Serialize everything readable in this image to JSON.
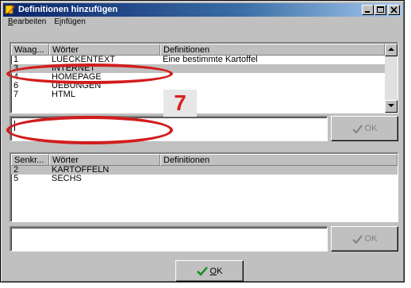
{
  "window": {
    "title": "Definitionen hinzufügen",
    "colors": {
      "titlebar": "#0a246a",
      "face": "#c0c0c0",
      "annotation": "#d21c1c"
    }
  },
  "menubar": {
    "items": [
      {
        "label": "Bearbeiten",
        "mnemonic": "B",
        "rest": "earbeiten"
      },
      {
        "label": "Einfügen",
        "mnemonic": "i",
        "pre": "E",
        "rest": "nfügen"
      }
    ]
  },
  "top_grid": {
    "headers": [
      "Waag...",
      "Wörter",
      "Definitionen"
    ],
    "rows": [
      {
        "num": "1",
        "word": "LUECKENTEXT",
        "def": "Eine bestimmte Kartoffel",
        "selected": false
      },
      {
        "num": "3",
        "word": "INTERNET",
        "def": "",
        "selected": true
      },
      {
        "num": "4",
        "word": "HOMEPAGE",
        "def": "",
        "selected": false
      },
      {
        "num": "6",
        "word": "UEBUNGEN",
        "def": "",
        "selected": false
      },
      {
        "num": "7",
        "word": "HTML",
        "def": "",
        "selected": false
      }
    ]
  },
  "top_input": {
    "value": ""
  },
  "top_ok": {
    "label": "OK"
  },
  "bottom_grid": {
    "headers": [
      "Senkr...",
      "Wörter",
      "Definitionen"
    ],
    "rows": [
      {
        "num": "2",
        "word": "KARTOFFELN",
        "def": "",
        "selected": true
      },
      {
        "num": "5",
        "word": "SECHS",
        "def": "",
        "selected": false
      }
    ]
  },
  "bottom_input": {
    "value": ""
  },
  "bottom_ok": {
    "label": "OK"
  },
  "main_ok": {
    "label": "OK",
    "mnemonic": "O",
    "rest": "K"
  },
  "annotation": {
    "number": "7"
  }
}
